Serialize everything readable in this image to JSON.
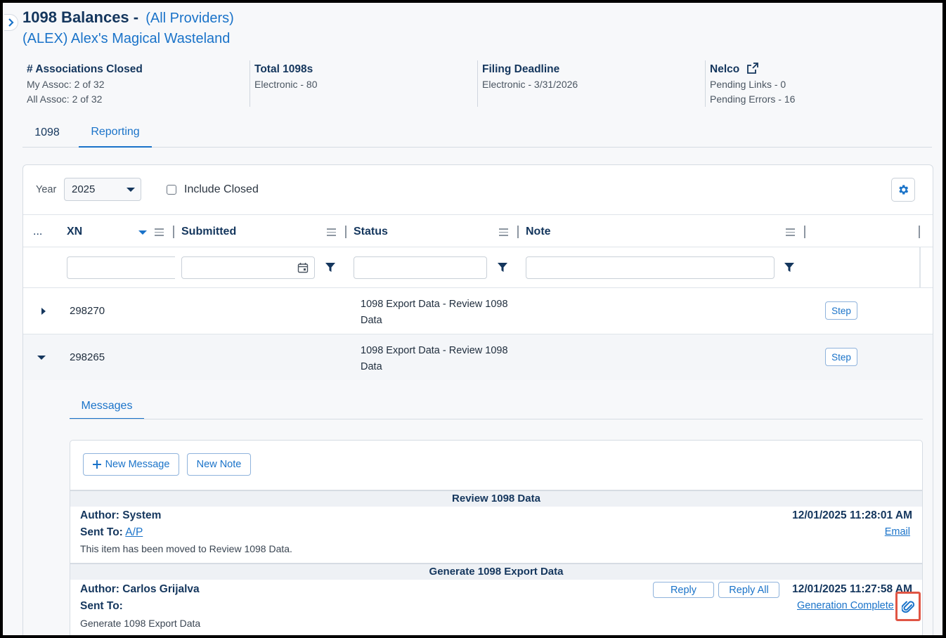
{
  "header": {
    "title": "1098 Balances -",
    "provider": "(All Providers)",
    "association": "(ALEX) Alex's Magical Wasteland"
  },
  "stats": {
    "assoc_closed": {
      "title": "# Associations Closed",
      "line1": "My Assoc: 2 of 32",
      "line2": "All Assoc: 2 of 32"
    },
    "total": {
      "title": "Total 1098s",
      "line1": "Electronic - 80"
    },
    "deadline": {
      "title": "Filing Deadline",
      "line1": "Electronic - 3/31/2026"
    },
    "nelco": {
      "title": "Nelco",
      "line1": "Pending Links - 0",
      "line2": "Pending Errors - 16"
    }
  },
  "tabs": [
    {
      "label": "1098"
    },
    {
      "label": "Reporting"
    }
  ],
  "active_tab": "Reporting",
  "filters": {
    "year_label": "Year",
    "year_value": "2025",
    "include_closed_label": "Include Closed",
    "include_closed_checked": false
  },
  "grid": {
    "columns": {
      "more": "...",
      "xn": "XN",
      "submitted": "Submitted",
      "status": "Status",
      "note": "Note"
    },
    "rows": [
      {
        "xn": "298270",
        "status": "1098 Export Data - Review 1098 Data",
        "expanded": false,
        "action": "Step"
      },
      {
        "xn": "298265",
        "status": "1098 Export Data - Review 1098 Data",
        "expanded": true,
        "action": "Step"
      }
    ]
  },
  "messages": {
    "tab_label": "Messages",
    "new_message_label": "New Message",
    "new_note_label": "New Note",
    "items": [
      {
        "heading": "Review 1098 Data",
        "author": "Author: System",
        "sent_to_label": "Sent To:",
        "sent_to": "A/P",
        "timestamp": "12/01/2025 11:28:01 AM",
        "link": "Email",
        "body": "This item has been moved to Review 1098 Data."
      },
      {
        "heading": "Generate 1098 Export Data",
        "author": "Author: Carlos Grijalva",
        "sent_to_label": "Sent To:",
        "sent_to": "",
        "timestamp": "12/01/2025 11:27:58 AM",
        "link": "Generation Complete",
        "reply_label": "Reply",
        "reply_all_label": "Reply All",
        "body": "Generate 1098 Export Data"
      }
    ]
  },
  "colors": {
    "accent": "#1a73c9",
    "navy": "#14365d",
    "highlight": "#e05544"
  }
}
